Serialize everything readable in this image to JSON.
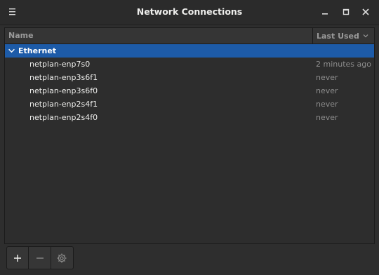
{
  "window": {
    "title": "Network Connections"
  },
  "icons": {
    "menu": "hamburger-menu-icon",
    "minimize": "minimize-icon",
    "maximize": "maximize-icon",
    "close": "close-icon",
    "add": "plus-icon",
    "remove": "minus-icon",
    "settings": "gear-icon",
    "expand": "chevron-down-icon",
    "sort": "chevron-down-icon"
  },
  "table": {
    "columns": [
      "Name",
      "Last Used"
    ],
    "group": {
      "label": "Ethernet"
    },
    "rows": [
      {
        "name": "netplan-enp7s0",
        "last_used": "2 minutes ago"
      },
      {
        "name": "netplan-enp3s6f1",
        "last_used": "never"
      },
      {
        "name": "netplan-enp3s6f0",
        "last_used": "never"
      },
      {
        "name": "netplan-enp2s4f1",
        "last_used": "never"
      },
      {
        "name": "netplan-enp2s4f0",
        "last_used": "never"
      }
    ]
  },
  "colors": {
    "selection": "#1d5ba8",
    "background": "#2e2e2e",
    "muted_text": "#8d8d8d"
  }
}
